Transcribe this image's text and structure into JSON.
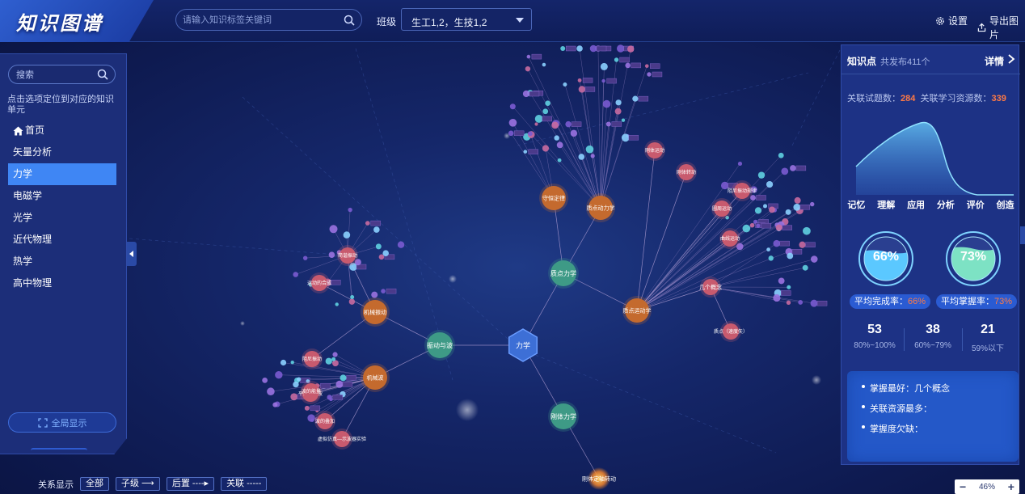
{
  "app": {
    "title": "知识图谱"
  },
  "header": {
    "search_placeholder": "请输入知识标签关键词",
    "class_label": "班级",
    "class_value": "生工1,2，生技1,2",
    "settings_label": "设置",
    "export_label": "导出图片"
  },
  "sidebar": {
    "search_placeholder": "搜索",
    "hint": "点击选项定位到对应的知识单元",
    "items": [
      {
        "label": "首页"
      },
      {
        "label": "矢量分析"
      },
      {
        "label": "力学"
      },
      {
        "label": "电磁学"
      },
      {
        "label": "光学"
      },
      {
        "label": "近代物理"
      },
      {
        "label": "热学"
      },
      {
        "label": "高中物理"
      }
    ],
    "active_index": 2,
    "global_button": "全局显示"
  },
  "graph": {
    "root": "力学",
    "primary": [
      "质点力学",
      "振动与波",
      "刚体力学"
    ],
    "secondary": [
      "守恒定律",
      "质点动力学",
      "质点运动学",
      "机械振动",
      "机械波",
      "几个概念",
      "刚体定轴转动"
    ],
    "tertiary": [
      "简谐振动",
      "运动的合成",
      "阻尼振动",
      "平面简谐波",
      "波的叠加",
      "波的能量",
      "曲线运动",
      "圆周运动",
      "刚体运动",
      "刚体转动",
      "质点（速度矢）",
      "阻尼振动规律",
      "虚拟仿真—示波器实验"
    ]
  },
  "relations": {
    "label": "关系显示",
    "buttons": [
      "全部",
      "子级 ⟶",
      "后置 ----▸",
      "关联 -----"
    ]
  },
  "zoom": {
    "minus": "−",
    "value": "46%",
    "plus": "+"
  },
  "right_panel": {
    "title": "知识点",
    "count_text": "共发布411个",
    "detail_label": "详情",
    "stats": {
      "tests_label": "关联试题数：",
      "tests_value": "284",
      "resources_label": "关联学习资源数：",
      "resources_value": "339"
    },
    "bloom_levels": [
      "记忆",
      "理解",
      "应用",
      "分析",
      "评价",
      "创造"
    ],
    "completion": {
      "value": "66%",
      "fraction": 0.66,
      "label": "平均完成率：",
      "color": "#5bc8ff"
    },
    "mastery": {
      "value": "73%",
      "fraction": 0.73,
      "label": "平均掌握率：",
      "color": "#7de2c4"
    },
    "distribution": [
      {
        "count": "53",
        "range": "80%~100%"
      },
      {
        "count": "38",
        "range": "60%~79%"
      },
      {
        "count": "21",
        "range": "59%以下"
      }
    ],
    "summary": [
      "掌握最好：几个概念",
      "关联资源最多：",
      "掌握度欠缺："
    ]
  },
  "colors": {
    "accent": "#3f86f4",
    "highlight": "#ff7a45",
    "root_node": "#3d6fd6",
    "primary_node": "#3e9a86",
    "secondary_node": "#c46a2e",
    "tertiary_node": "#c85a6e"
  }
}
